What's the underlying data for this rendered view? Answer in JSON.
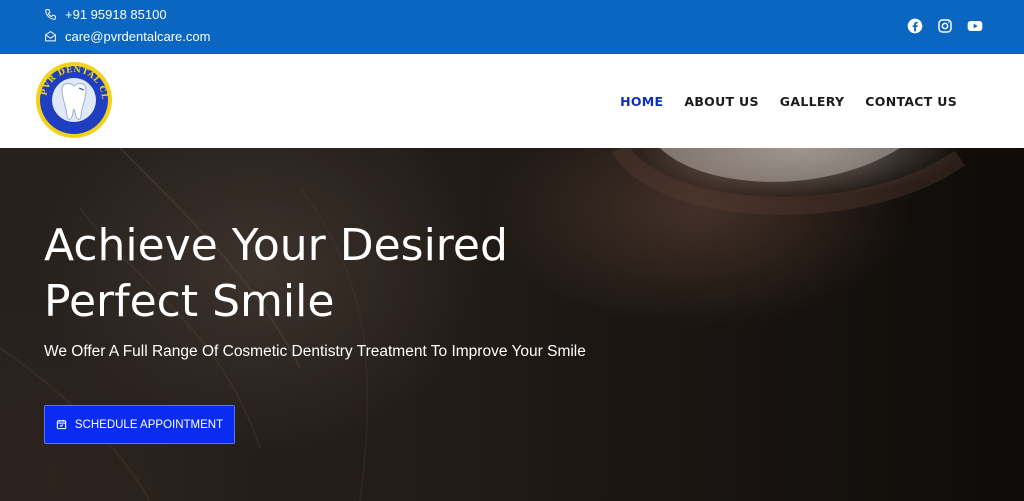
{
  "topbar": {
    "phone": "+91 95918 85100",
    "email": "care@pvrdentalcare.com",
    "socials": [
      "facebook-icon",
      "instagram-icon",
      "youtube-icon"
    ],
    "bg_color": "#0a66c0"
  },
  "brand": {
    "logo_text": "PVR DENTAL CLINIC"
  },
  "nav": {
    "items": [
      {
        "label": "HOME",
        "active": true
      },
      {
        "label": "ABOUT US",
        "active": false
      },
      {
        "label": "GALLERY",
        "active": false
      },
      {
        "label": "CONTACT US",
        "active": false
      }
    ],
    "active_color": "#0f2fbf"
  },
  "hero": {
    "title_line1": "Achieve Your Desired",
    "title_line2": "Perfect Smile",
    "subtitle": "We Offer A Full Range Of Cosmetic Dentistry Treatment To Improve Your Smile",
    "cta_label": "SCHEDULE APPOINTMENT",
    "cta_icon": "calendar-icon",
    "cta_color": "#0a2cf0"
  }
}
